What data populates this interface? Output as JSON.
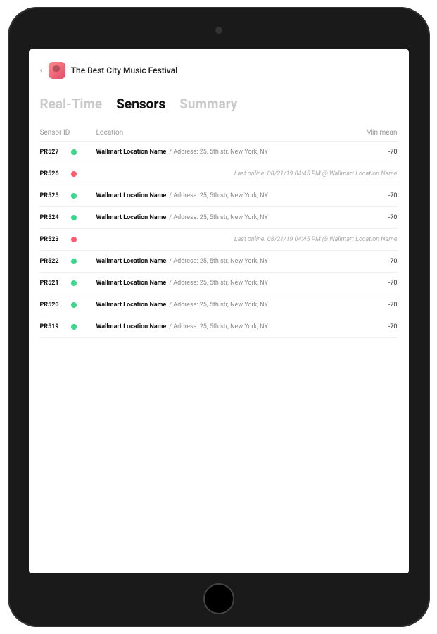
{
  "header": {
    "event_title": "The Best City Music Festival"
  },
  "tabs": [
    {
      "label": "Real-Time",
      "active": false
    },
    {
      "label": "Sensors",
      "active": true
    },
    {
      "label": "Summary",
      "active": false
    }
  ],
  "columns": {
    "id": "Sensor ID",
    "location": "Location",
    "mean": "Min mean"
  },
  "colors": {
    "online": "#3dd68c",
    "offline": "#ff5a6e"
  },
  "sensors": [
    {
      "id": "PR527",
      "status": "online",
      "location_name": "Wallmart Location Name",
      "address": "/ Address: 25, 5th str, New York, NY",
      "min_mean": "-70"
    },
    {
      "id": "PR526",
      "status": "offline",
      "offline_text": "Last online: 08/21/19 04:45 PM @ Wallmart Location Name"
    },
    {
      "id": "PR525",
      "status": "online",
      "location_name": "Wallmart Location Name",
      "address": "/ Address: 25, 5th str, New York, NY",
      "min_mean": "-70"
    },
    {
      "id": "PR524",
      "status": "online",
      "location_name": "Wallmart Location Name",
      "address": "/ Address: 25, 5th str, New York, NY",
      "min_mean": "-70"
    },
    {
      "id": "PR523",
      "status": "offline",
      "offline_text": "Last online: 08/21/19 04:45 PM @ Wallmart Location Name"
    },
    {
      "id": "PR522",
      "status": "online",
      "location_name": "Wallmart Location Name",
      "address": "/ Address: 25, 5th str, New York, NY",
      "min_mean": "-70"
    },
    {
      "id": "PR521",
      "status": "online",
      "location_name": "Wallmart Location Name",
      "address": "/ Address: 25, 5th str, New York, NY",
      "min_mean": "-70"
    },
    {
      "id": "PR520",
      "status": "online",
      "location_name": "Wallmart Location Name",
      "address": "/ Address: 25, 5th str, New York, NY",
      "min_mean": "-70"
    },
    {
      "id": "PR519",
      "status": "online",
      "location_name": "Wallmart Location Name",
      "address": "/ Address: 25, 5th str, New York, NY",
      "min_mean": "-70"
    }
  ]
}
